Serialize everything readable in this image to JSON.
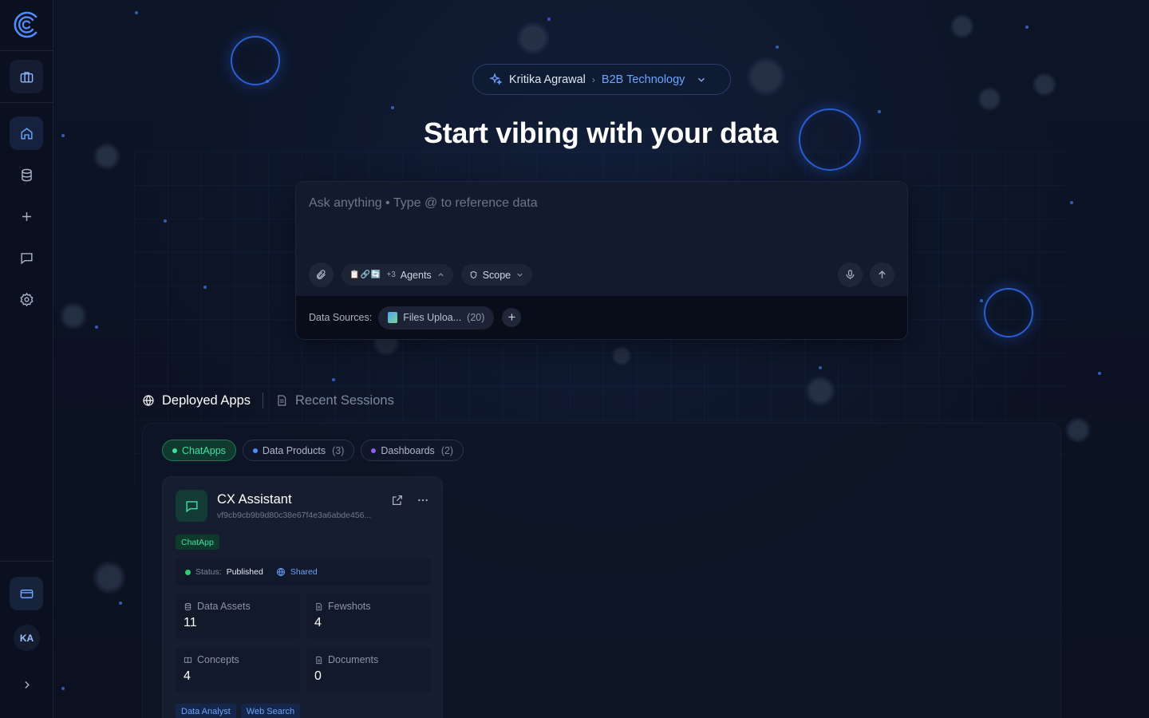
{
  "sidebar": {
    "logo_icon": "brand-c-logo",
    "nav": [
      {
        "icon": "briefcase-icon",
        "active": false
      },
      {
        "icon": "home-icon",
        "active": true
      },
      {
        "icon": "database-icon",
        "active": false
      },
      {
        "icon": "plus-icon",
        "active": false
      },
      {
        "icon": "chat-icon",
        "active": false
      },
      {
        "icon": "gear-icon",
        "active": false
      }
    ],
    "billing_icon": "credit-card-icon",
    "avatar_initials": "KA",
    "expand_icon": "chevron-right-icon"
  },
  "breadcrumb": {
    "user": "Kritika Agrawal",
    "separator": "›",
    "org": "B2B Technology"
  },
  "headline": "Start vibing with your data",
  "prompt": {
    "placeholder": "Ask anything • Type @ to reference data",
    "agents_extra": "+3",
    "agents_label": "Agents",
    "agents_glyphs": "📋🔗🔄",
    "scope_label": "Scope",
    "data_sources_label": "Data Sources:",
    "source_name": "Files Uploa...",
    "source_count": "(20)",
    "add_label": "+"
  },
  "tabs": [
    {
      "label": "Deployed Apps",
      "active": true,
      "icon": "globe-icon"
    },
    {
      "label": "Recent Sessions",
      "active": false,
      "icon": "document-icon"
    }
  ],
  "filters": [
    {
      "label": "ChatApps",
      "count": "",
      "active": true,
      "color": "#3ee0a0"
    },
    {
      "label": "Data Products",
      "count": "(3)",
      "active": false,
      "color": "#4f8dff"
    },
    {
      "label": "Dashboards",
      "count": "(2)",
      "active": false,
      "color": "#8b5cf6"
    }
  ],
  "app_card": {
    "title": "CX Assistant",
    "id": "vf9cb9cb9b9d80c38e67f4e3a6abde456...",
    "tag": "ChatApp",
    "status_label": "Status:",
    "status_value": "Published",
    "shared_label": "Shared",
    "stats": [
      {
        "label": "Data Assets",
        "value": "11",
        "icon": "database-icon"
      },
      {
        "label": "Fewshots",
        "value": "4",
        "icon": "document-icon"
      },
      {
        "label": "Concepts",
        "value": "4",
        "icon": "book-icon"
      },
      {
        "label": "Documents",
        "value": "0",
        "icon": "document-icon"
      }
    ],
    "capabilities": [
      "Data Analyst",
      "Web Search"
    ]
  },
  "colors": {
    "accent": "#6aa5ff",
    "success": "#3ee0a0",
    "background": "#0b1222"
  }
}
